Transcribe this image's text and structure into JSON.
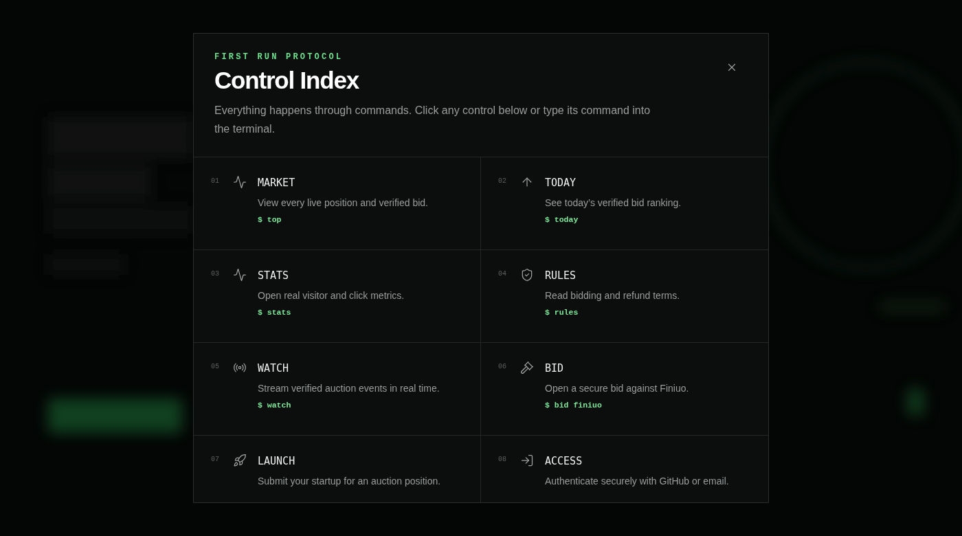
{
  "dialog": {
    "eyebrow": "FIRST RUN PROTOCOL",
    "title": "Control Index",
    "intro": "Everything happens through commands. Click any control below or type its command into the terminal.",
    "controls": [
      {
        "number": "01",
        "name": "MARKET",
        "description": "View every live position and verified bid.",
        "command": "$ top"
      },
      {
        "number": "02",
        "name": "TODAY",
        "description": "See today’s verified bid ranking.",
        "command": "$ today"
      },
      {
        "number": "03",
        "name": "STATS",
        "description": "Open real visitor and click metrics.",
        "command": "$ stats"
      },
      {
        "number": "04",
        "name": "RULES",
        "description": "Read bidding and refund terms.",
        "command": "$ rules"
      },
      {
        "number": "05",
        "name": "WATCH",
        "description": "Stream verified auction events in real time.",
        "command": "$ watch"
      },
      {
        "number": "06",
        "name": "BID",
        "description": "Open a secure bid against Finiuo.",
        "command": "$ bid finiuo"
      },
      {
        "number": "07",
        "name": "LAUNCH",
        "description": "Submit your startup for an auction position."
      },
      {
        "number": "08",
        "name": "ACCESS",
        "description": "Authenticate securely with GitHub or email."
      }
    ]
  }
}
